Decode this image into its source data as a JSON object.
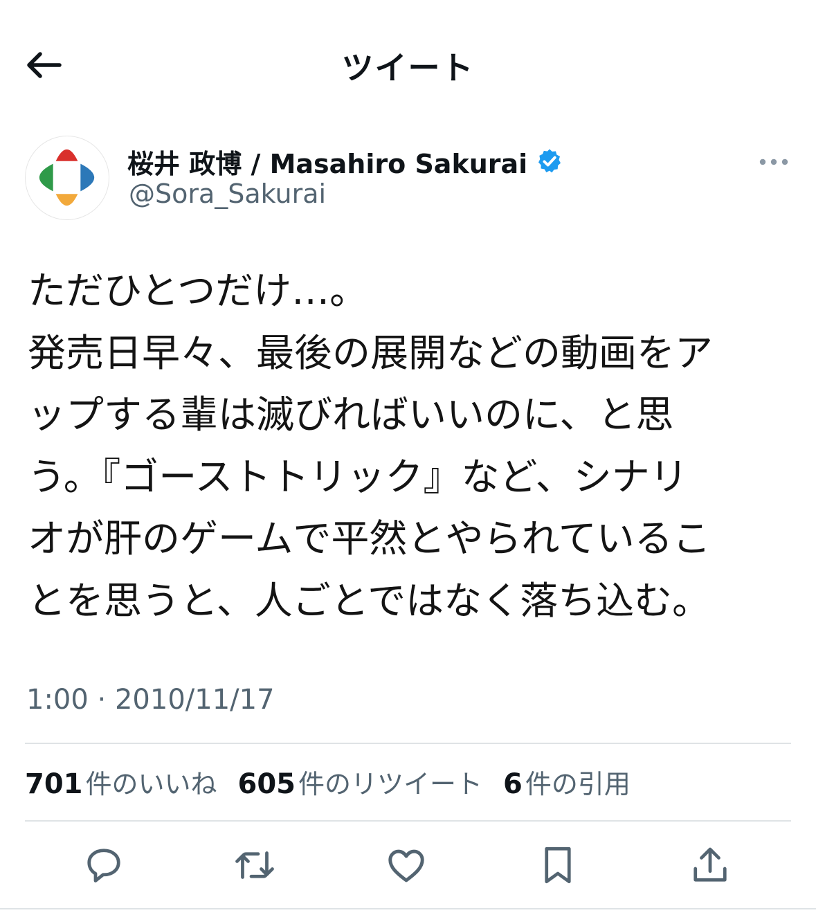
{
  "header": {
    "title": "ツイート",
    "back_icon": "arrow-left-icon"
  },
  "author": {
    "display_name": "桜井 政博 / Masahiro Sakurai",
    "handle": "@Sora_Sakurai",
    "verified": true,
    "verified_color": "#1d9bf0",
    "avatar_colors": {
      "top": "#d9302c",
      "left": "#2f9a49",
      "right": "#2c78b8",
      "bottom": "#f2a93b"
    }
  },
  "tweet": {
    "lines": [
      "ただひとつだけ…。",
      "発売日早々、最後の展開などの動画をア",
      "ップする輩は滅びればいいのに、と思",
      "う。『ゴーストトリック』など、シナリ",
      "オが肝のゲームで平然とやられているこ",
      "とを思うと、人ごとではなく落ち込む。"
    ],
    "timestamp": "1:00 · 2010/11/17"
  },
  "stats": [
    {
      "count": "701",
      "label": "件のいいね"
    },
    {
      "count": "605",
      "label": "件のリツイート"
    },
    {
      "count": "6",
      "label": "件の引用"
    }
  ],
  "actions": [
    "reply-icon",
    "retweet-icon",
    "like-icon",
    "bookmark-icon",
    "share-icon"
  ],
  "colors": {
    "text": "#0f1419",
    "secondary_text": "#536471",
    "divider": "#dfe3e6"
  }
}
